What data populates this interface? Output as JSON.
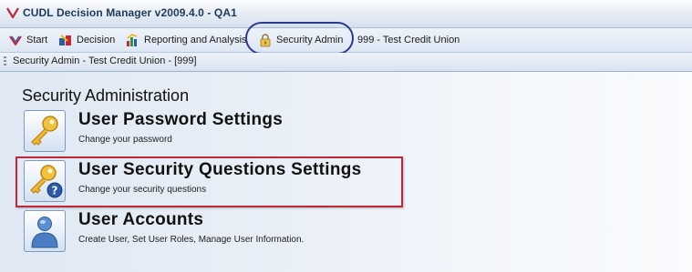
{
  "window": {
    "title": "CUDL Decision Manager v2009.4.0 - QA1"
  },
  "menubar": {
    "items": [
      {
        "label": "Start",
        "icon": "start-icon"
      },
      {
        "label": "Decision",
        "icon": "decision-icon"
      },
      {
        "label": "Reporting and Analysis",
        "icon": "reporting-icon"
      },
      {
        "label": "Security Admin",
        "icon": "lock-icon"
      }
    ],
    "context": "999 - Test Credit Union"
  },
  "tab": {
    "label": "Security Admin - Test Credit Union - [999]"
  },
  "main": {
    "title": "Security Administration",
    "options": [
      {
        "title": "User Password Settings",
        "description": "Change your password",
        "icon": "key-icon"
      },
      {
        "title": "User Security Questions Settings",
        "description": "Change your security questions",
        "icon": "key-question-icon"
      },
      {
        "title": "User Accounts",
        "description": "Create User, Set User Roles, Manage User Information.",
        "icon": "user-icon"
      }
    ]
  },
  "colors": {
    "annotation_oval": "#2b3a8f",
    "annotation_box": "#c0283a"
  }
}
